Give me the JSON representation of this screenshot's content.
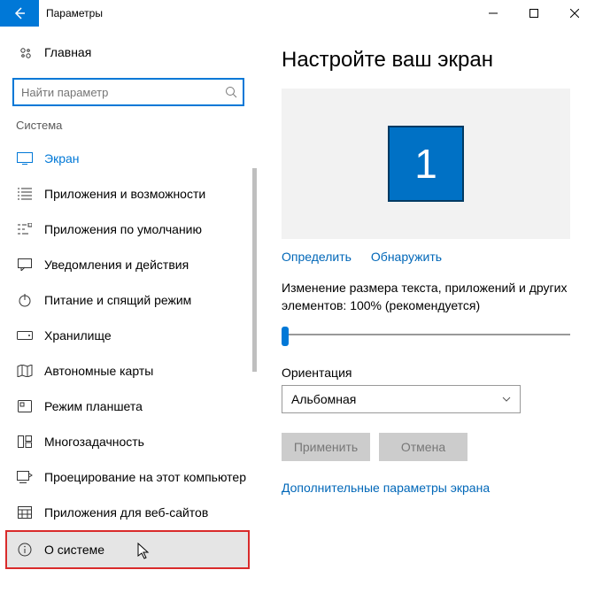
{
  "window": {
    "title": "Параметры"
  },
  "sidebar": {
    "home": "Главная",
    "search_placeholder": "Найти параметр",
    "group": "Система",
    "items": [
      {
        "label": "Экран"
      },
      {
        "label": "Приложения и возможности"
      },
      {
        "label": "Приложения по умолчанию"
      },
      {
        "label": "Уведомления и действия"
      },
      {
        "label": "Питание и спящий режим"
      },
      {
        "label": "Хранилище"
      },
      {
        "label": "Автономные карты"
      },
      {
        "label": "Режим планшета"
      },
      {
        "label": "Многозадачность"
      },
      {
        "label": "Проецирование на этот компьютер"
      },
      {
        "label": "Приложения для веб-сайтов"
      },
      {
        "label": "О системе"
      }
    ]
  },
  "main": {
    "title": "Настройте ваш экран",
    "monitor_id": "1",
    "identify": "Определить",
    "detect": "Обнаружить",
    "scale_text": "Изменение размера текста, приложений и других элементов: 100% (рекомендуется)",
    "orientation_label": "Ориентация",
    "orientation_value": "Альбомная",
    "apply": "Применить",
    "cancel": "Отмена",
    "advanced": "Дополнительные параметры экрана"
  }
}
